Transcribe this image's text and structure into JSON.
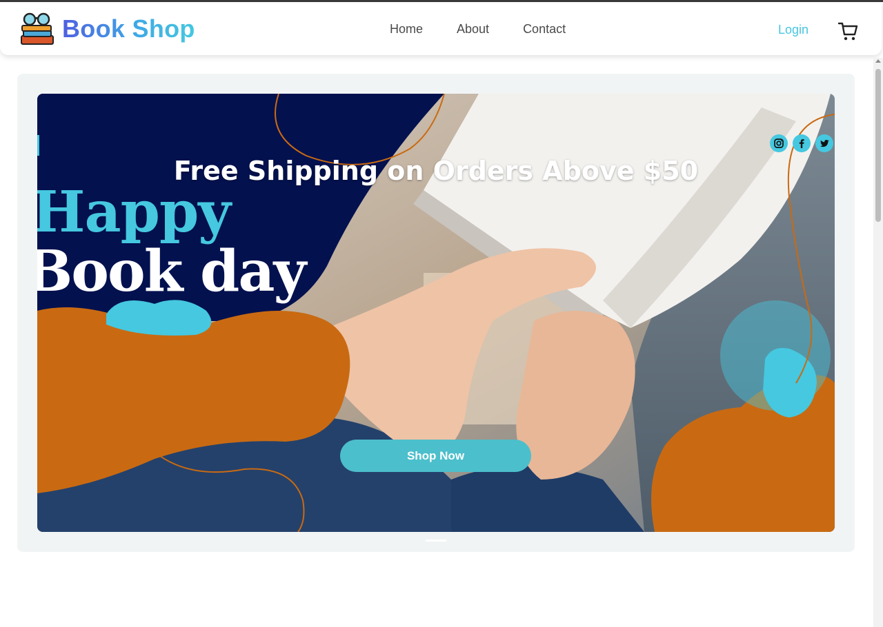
{
  "header": {
    "brand": "Book Shop",
    "nav": [
      "Home",
      "About",
      "Contact"
    ],
    "login_label": "Login"
  },
  "hero": {
    "headline": "Free Shipping on Orders Above $50",
    "art_line1": "Happy",
    "art_line2": "Book day",
    "cta_label": "Shop Now",
    "socials": [
      "instagram-icon",
      "facebook-icon",
      "twitter-icon"
    ]
  },
  "colors": {
    "accent": "#45c8e0",
    "brand_gradient_start": "#4f5fe0",
    "navy": "#03114f",
    "orange": "#c96a12",
    "button": "#4cbfcc"
  }
}
